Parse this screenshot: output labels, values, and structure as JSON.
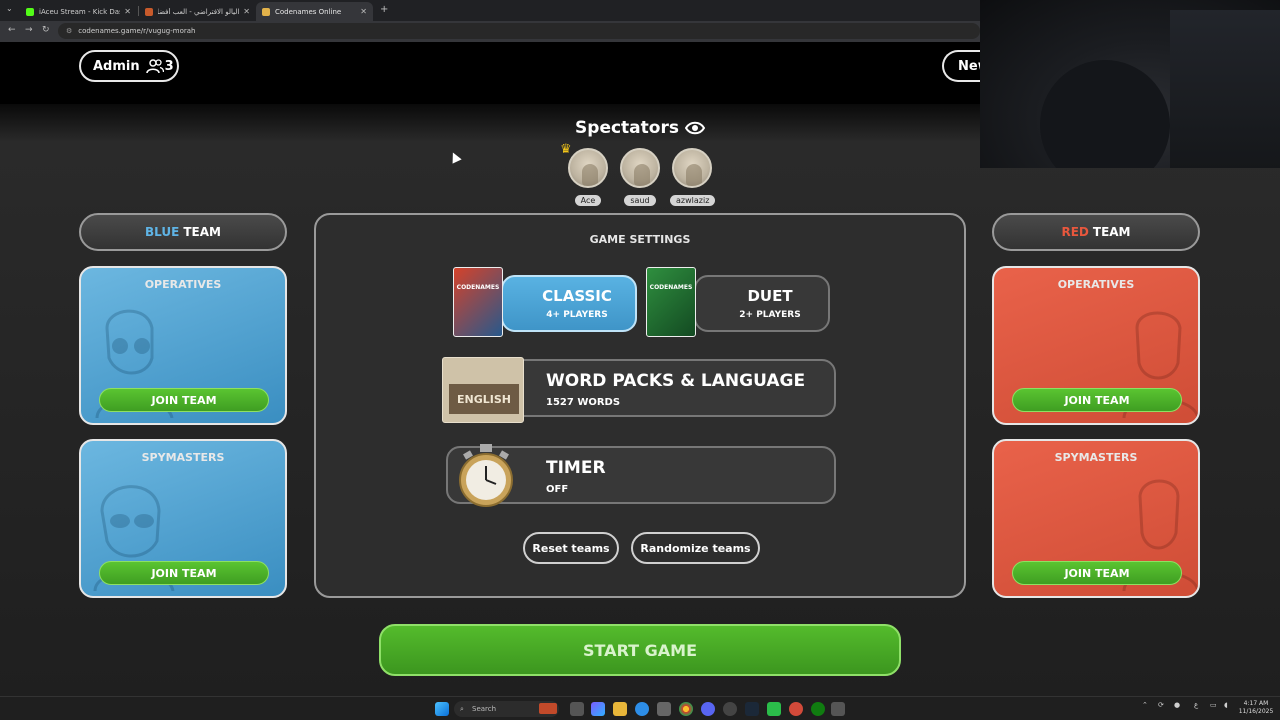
{
  "browser": {
    "tabs": [
      {
        "title": "iAceu Stream - Kick Dashboard",
        "color": "#53fc18"
      },
      {
        "title": "اليالو الافتراضي - العب أفضل ل...",
        "color": "#c85a2b"
      },
      {
        "title": "Codenames Online",
        "color": "#e2b24a"
      }
    ],
    "new_tab": "+",
    "url": "codenames.game/r/vugug-morah",
    "nav": {
      "back": "←",
      "forward": "→",
      "reload": "↻"
    }
  },
  "header": {
    "admin_label": "Admin",
    "player_count": "3",
    "new_label": "New"
  },
  "spectators": {
    "title": "Spectators",
    "players": [
      {
        "name": "Ace"
      },
      {
        "name": "saud"
      },
      {
        "name": "azwlaziz"
      }
    ]
  },
  "blue_team": {
    "name_color": "BLUE",
    "name_rest": "TEAM",
    "operatives_title": "OPERATIVES",
    "operatives_join": "JOIN TEAM",
    "spymasters_title": "SPYMASTERS",
    "spymasters_join": "JOIN TEAM"
  },
  "red_team": {
    "name_color": "RED",
    "name_rest": "TEAM",
    "operatives_title": "OPERATIVES",
    "operatives_join": "JOIN TEAM",
    "spymasters_title": "SPYMASTERS",
    "spymasters_join": "JOIN TEAM"
  },
  "settings": {
    "title": "GAME SETTINGS",
    "modes": [
      {
        "title": "CLASSIC",
        "sub": "4+ PLAYERS",
        "box_label": "CODENAMES"
      },
      {
        "title": "DUET",
        "sub": "2+ PLAYERS",
        "box_label": "CODENAMES"
      }
    ],
    "word_packs": {
      "title": "WORD PACKS & LANGUAGE",
      "sub": "1527 WORDS",
      "lang": "ENGLISH"
    },
    "timer": {
      "title": "TIMER",
      "sub": "OFF"
    },
    "reset_label": "Reset teams",
    "randomize_label": "Randomize teams"
  },
  "start_label": "START GAME",
  "taskbar": {
    "search": "Search",
    "time": "4:17 AM",
    "date": "11/16/2025",
    "lang": "ع"
  }
}
